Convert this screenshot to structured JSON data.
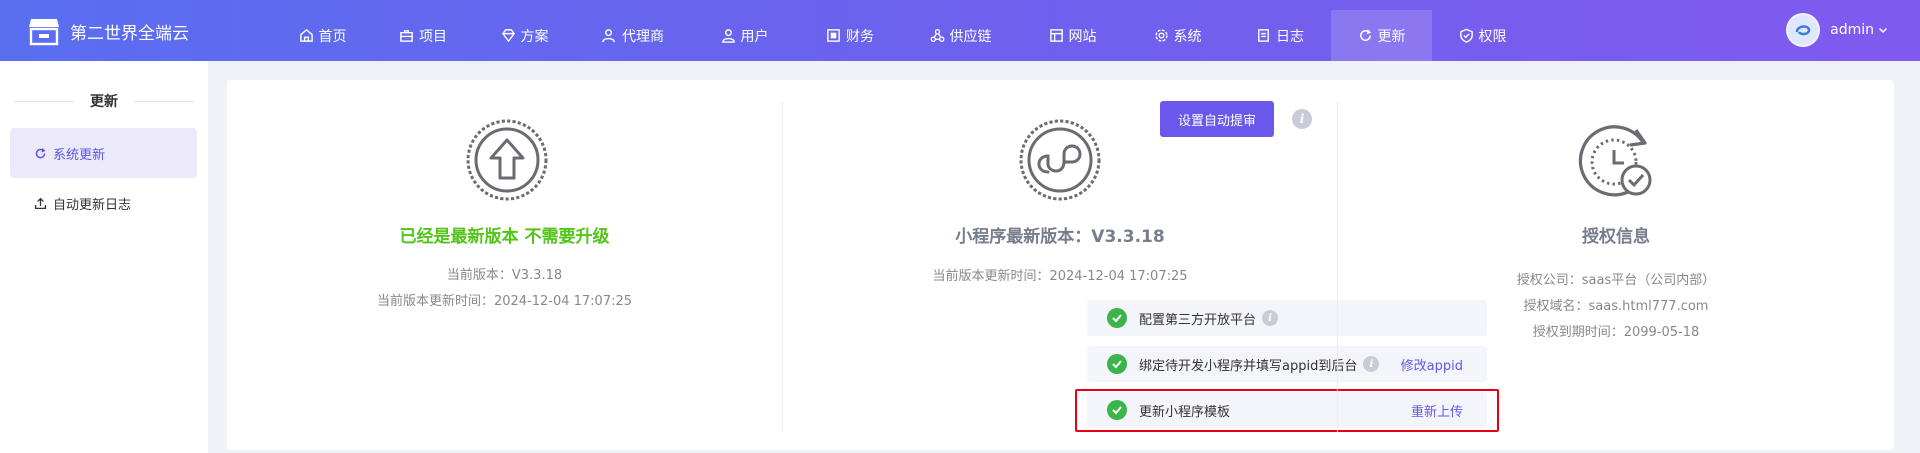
{
  "app": {
    "logo_text": "第二世界全端云"
  },
  "nav": {
    "items": [
      {
        "label": "首页",
        "icon": "home-icon"
      },
      {
        "label": "项目",
        "icon": "briefcase-icon"
      },
      {
        "label": "方案",
        "icon": "diamond-icon"
      },
      {
        "label": "代理商",
        "icon": "user-star-icon"
      },
      {
        "label": "用户",
        "icon": "users-icon"
      },
      {
        "label": "财务",
        "icon": "finance-icon"
      },
      {
        "label": "供应链",
        "icon": "supply-chain-icon"
      },
      {
        "label": "网站",
        "icon": "website-icon"
      },
      {
        "label": "系统",
        "icon": "gear-icon"
      },
      {
        "label": "日志",
        "icon": "log-icon"
      },
      {
        "label": "更新",
        "icon": "refresh-icon",
        "active": true
      },
      {
        "label": "权限",
        "icon": "shield-check-icon"
      }
    ]
  },
  "user": {
    "name": "admin"
  },
  "sidebar": {
    "title": "更新",
    "items": [
      {
        "label": "系统更新",
        "icon": "refresh-icon",
        "active": true
      },
      {
        "label": "自动更新日志",
        "icon": "upload-icon"
      }
    ]
  },
  "system": {
    "title": "已经是最新版本 不需要升级",
    "current_version": "当前版本：V3.3.18",
    "update_time": "当前版本更新时间：2024-12-04 17:07:25"
  },
  "miniprogram": {
    "auto_review_button": "设置自动提审",
    "title": "小程序最新版本：V3.3.18",
    "update_time": "当前版本更新时间：2024-12-04 17:07:25",
    "steps": [
      {
        "label": "配置第三方开放平台",
        "link": ""
      },
      {
        "label": "绑定待开发小程序并填写appid到后台",
        "link": "修改appid"
      },
      {
        "label": "更新小程序模板",
        "link": "重新上传"
      }
    ]
  },
  "license": {
    "title": "授权信息",
    "company": "授权公司：saas平台（公司内部）",
    "domain": "授权域名：saas.html777.com",
    "expiry": "授权到期时间：2099-05-18"
  },
  "colors": {
    "nav_gradient_start": "#5a6ef0",
    "nav_gradient_end": "#7f5aee",
    "accent": "#6a58ec",
    "success": "#3bb54a",
    "title_green": "#52c41a",
    "highlight_red": "#e60012"
  }
}
